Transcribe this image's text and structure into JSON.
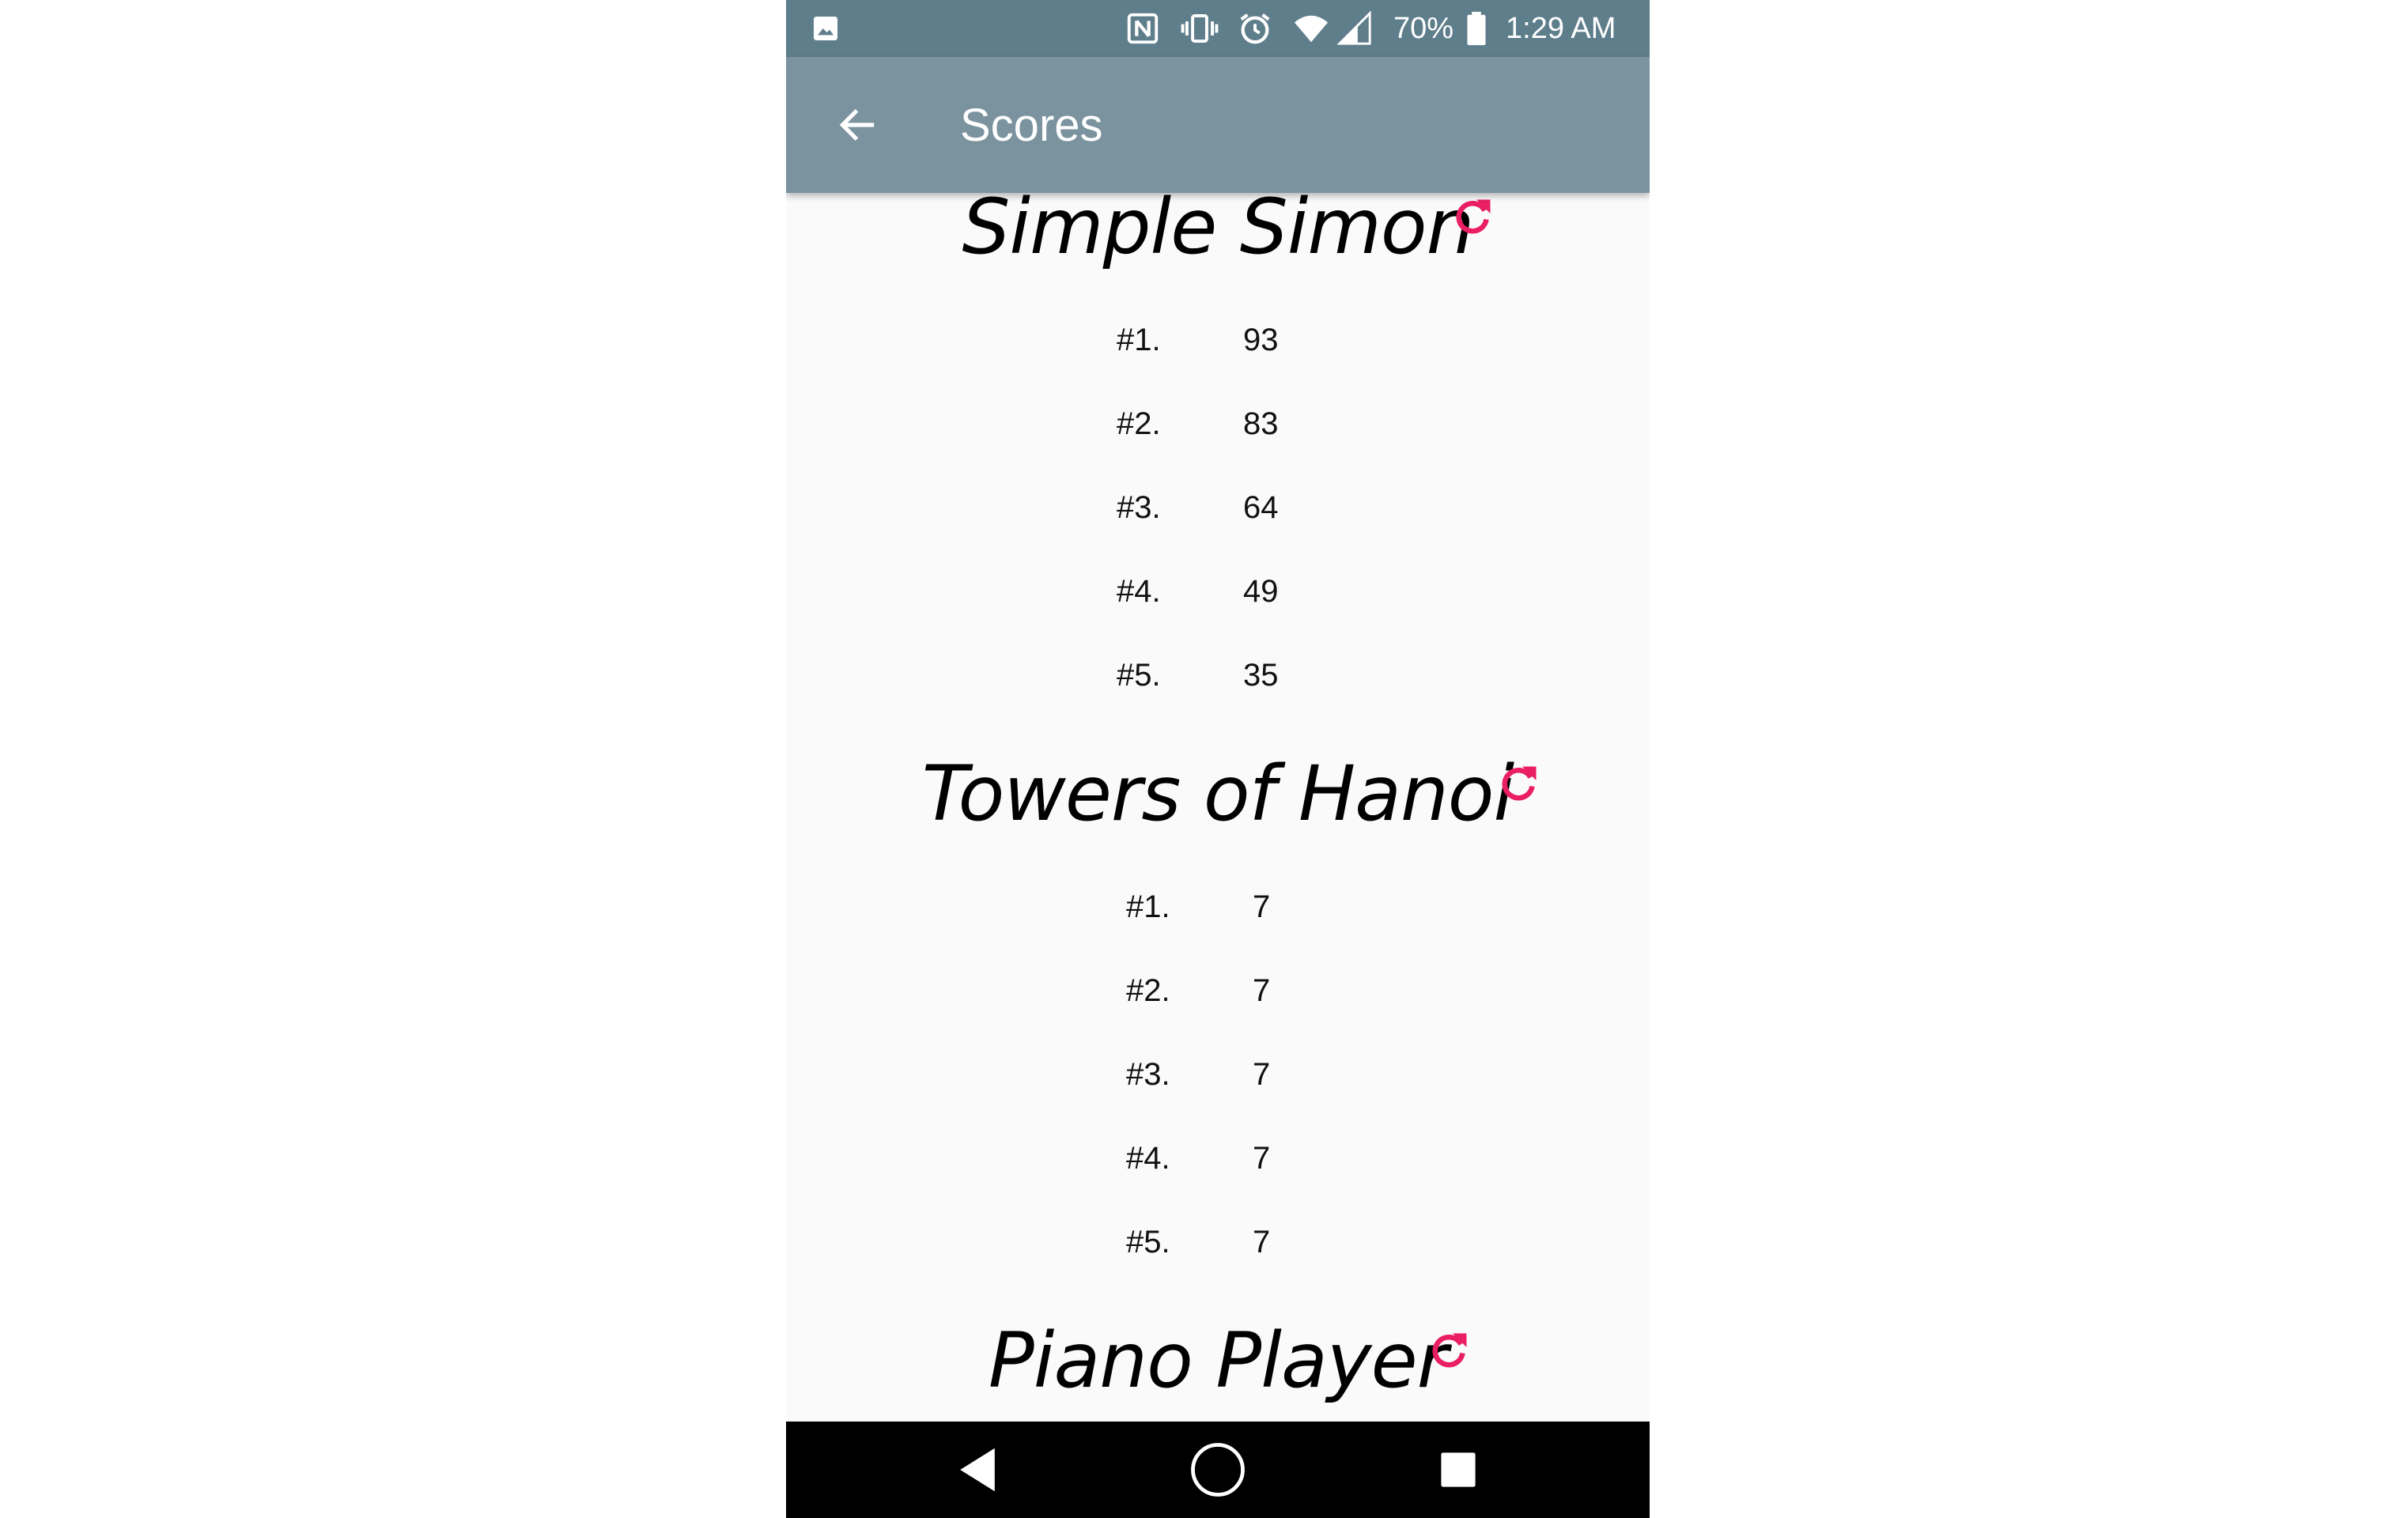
{
  "status_bar": {
    "battery_percent": "70%",
    "time": "1:29 AM",
    "icons": [
      "gallery-icon",
      "nfc-icon",
      "vibrate-icon",
      "alarm-icon",
      "wifi-icon",
      "signal-icon",
      "battery-icon"
    ]
  },
  "toolbar": {
    "title": "Scores",
    "back_icon": "arrow-left-icon"
  },
  "accent_color": "#e91e63",
  "toolbar_color": "#7a939f",
  "status_bar_color": "#5f7e8b",
  "games": [
    {
      "name": "Simple Simon",
      "refresh_icon": "refresh-icon",
      "scores": [
        {
          "rank": "#1.",
          "score": "93"
        },
        {
          "rank": "#2.",
          "score": "83"
        },
        {
          "rank": "#3.",
          "score": "64"
        },
        {
          "rank": "#4.",
          "score": "49"
        },
        {
          "rank": "#5.",
          "score": "35"
        }
      ]
    },
    {
      "name": "Towers of Hanoi",
      "refresh_icon": "refresh-icon",
      "scores": [
        {
          "rank": "#1.",
          "score": "7"
        },
        {
          "rank": "#2.",
          "score": "7"
        },
        {
          "rank": "#3.",
          "score": "7"
        },
        {
          "rank": "#4.",
          "score": "7"
        },
        {
          "rank": "#5.",
          "score": "7"
        }
      ]
    },
    {
      "name": "Piano Player",
      "refresh_icon": "refresh-icon",
      "scores": []
    }
  ],
  "nav_bar": {
    "icons": [
      "nav-back-icon",
      "nav-home-icon",
      "nav-recents-icon"
    ]
  }
}
